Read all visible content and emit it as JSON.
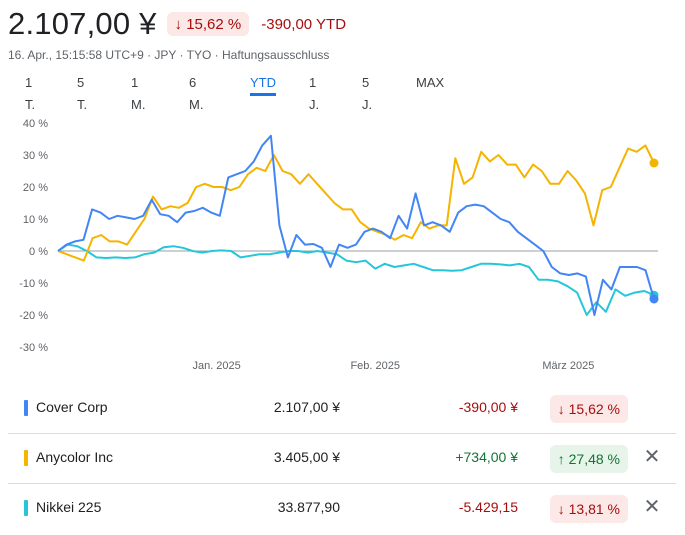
{
  "header": {
    "price": "2.107,00 ¥",
    "change_pct": "15,62 %",
    "change_abs": "-390,00 YTD",
    "meta": "16. Apr., 15:15:58 UTC+9 · JPY · TYO · Haftungsausschluss"
  },
  "tabs": [
    {
      "label": "1 T.",
      "active": false
    },
    {
      "label": "5 T.",
      "active": false
    },
    {
      "label": "1 M.",
      "active": false
    },
    {
      "label": "6 M.",
      "active": false
    },
    {
      "label": "YTD",
      "active": true
    },
    {
      "label": "1 J.",
      "active": false
    },
    {
      "label": "5 J.",
      "active": false
    },
    {
      "label": "MAX",
      "active": false
    }
  ],
  "arrow_down": "↓",
  "arrow_up": "↑",
  "close_glyph": "✕",
  "chart_data": {
    "type": "line",
    "y_unit": "%",
    "ylim": [
      -30,
      40
    ],
    "y_ticks": [
      "40 %",
      "30 %",
      "20 %",
      "10 %",
      "0 %",
      "-10 %",
      "-20 %",
      "-30 %"
    ],
    "x_tick_labels": [
      {
        "label": "Jan. 2025",
        "at": 23
      },
      {
        "label": "Feb. 2025",
        "at": 46
      },
      {
        "label": "März 2025",
        "at": 74
      }
    ],
    "x_count": 88,
    "grid": false,
    "zero_line": true,
    "series": [
      {
        "name": "Cover Corp",
        "color": "#4285f4",
        "values": [
          0,
          2,
          3,
          3.5,
          13,
          12,
          10,
          11,
          10.5,
          10,
          11,
          16,
          11.5,
          11,
          9,
          12,
          12.5,
          13.5,
          12,
          11,
          23,
          24,
          25,
          28,
          33,
          36,
          8,
          -2,
          5,
          2,
          2.2,
          1,
          -5,
          2,
          1,
          2,
          6,
          7,
          6,
          4,
          11,
          7,
          18,
          8,
          9,
          8,
          6,
          12,
          14,
          14.5,
          14,
          12,
          10,
          9,
          6,
          4,
          2,
          0,
          -5,
          -7,
          -7.5,
          -7,
          -8,
          -20,
          -9,
          -12,
          -5,
          -5,
          -5,
          -6,
          -15
        ]
      },
      {
        "name": "Anycolor Inc",
        "color": "#f4b400",
        "values": [
          0,
          -1,
          -2,
          -3,
          4,
          5,
          3,
          3,
          2,
          6,
          10,
          17,
          13,
          14,
          13.5,
          15,
          20,
          21,
          20,
          20,
          19,
          20,
          24,
          26,
          25,
          30,
          25,
          24,
          21,
          24,
          21,
          18,
          15,
          13,
          13,
          9,
          7,
          6,
          5,
          3.5,
          5,
          4,
          9,
          7,
          8,
          8,
          29,
          21,
          23,
          31,
          28,
          30,
          27,
          27,
          23,
          27,
          25,
          21,
          21,
          25,
          22,
          18,
          8,
          19,
          20,
          26,
          32,
          31,
          33,
          27.5
        ]
      },
      {
        "name": "Nikkei 225",
        "color": "#26c6da",
        "values": [
          0,
          2,
          1.5,
          0,
          -2,
          -2.2,
          -2,
          -2.2,
          -2,
          -1,
          -0.5,
          1.2,
          1.5,
          1,
          0,
          -0.5,
          0,
          0.2,
          0,
          -2,
          -1.5,
          -1,
          -1,
          -0.5,
          0,
          0,
          -0.5,
          0,
          -0.5,
          -1,
          -3,
          -3.5,
          -3,
          -5.5,
          -4,
          -5,
          -4.5,
          -4,
          -5,
          -6,
          -6,
          -6.2,
          -6,
          -5,
          -4,
          -4,
          -4.2,
          -4.5,
          -4,
          -5,
          -9,
          -9,
          -9.5,
          -11,
          -13,
          -20,
          -16,
          -19,
          -12,
          -14,
          -13,
          -12.5,
          -13.81
        ]
      }
    ]
  },
  "rows": [
    {
      "name": "Cover Corp",
      "value": "2.107,00 ¥",
      "change": "-390,00 ¥",
      "pct": "15,62 %",
      "dir": "neg",
      "removable": false,
      "color": "#4285f4"
    },
    {
      "name": "Anycolor Inc",
      "value": "3.405,00 ¥",
      "change": "+734,00 ¥",
      "pct": "27,48 %",
      "dir": "pos",
      "removable": true,
      "color": "#f4b400"
    },
    {
      "name": "Nikkei 225",
      "value": "33.877,90",
      "change": "-5.429,15",
      "pct": "13,81 %",
      "dir": "neg",
      "removable": true,
      "color": "#26c6da"
    }
  ]
}
